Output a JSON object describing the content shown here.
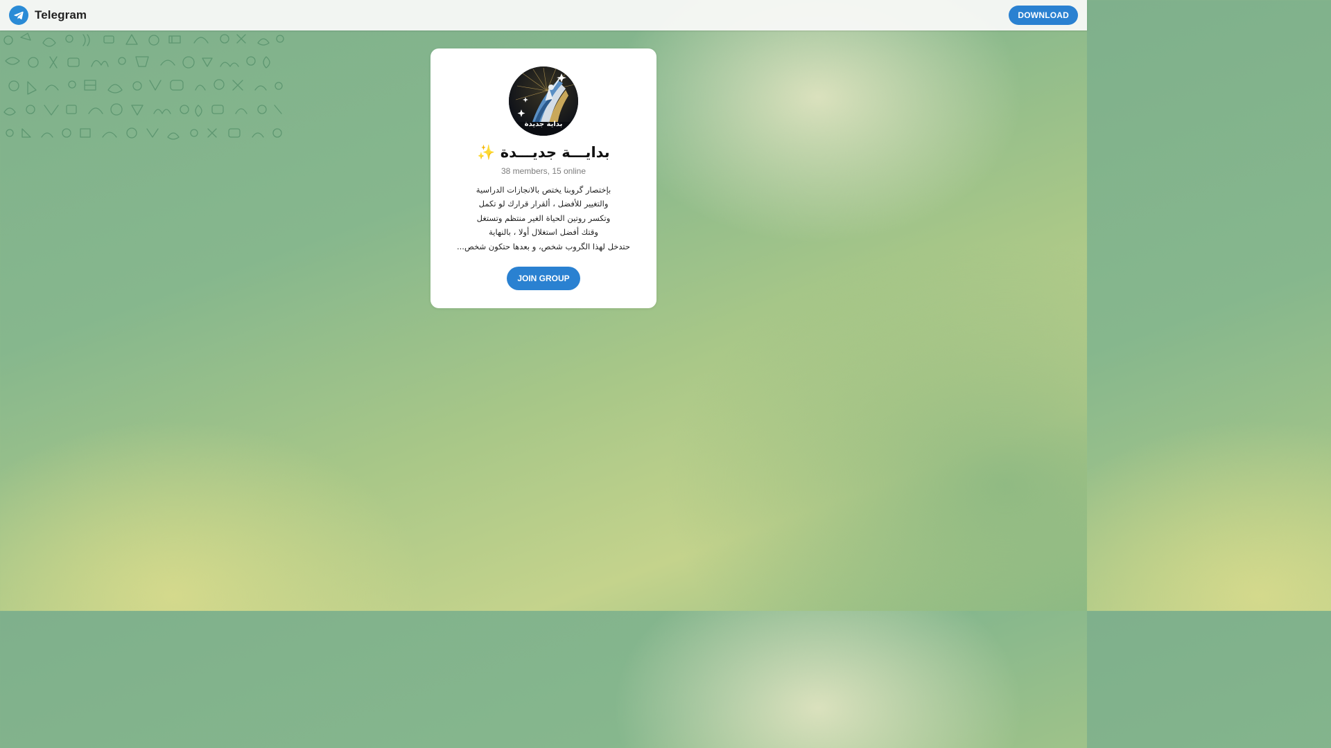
{
  "header": {
    "brand": "Telegram",
    "brand_icon": "telegram-paper-plane-icon",
    "download_label": "DOWNLOAD"
  },
  "group": {
    "avatar_caption": "بداية جديدة",
    "title": "بدايـــة جديـــدة ✨",
    "extra": "38 members, 15 online",
    "description_lines": [
      "بإختصار گروبنا يختص بالانجازات الدراسية",
      "والتغيير للأفضل ، ألقرار قرارك لو تكمل",
      "وتكسر روتين الحياة الغير منتظم وتستغل",
      "وقتك أفضل استغلال أولا ، بالنهاية",
      "حتدخل لهذا الگروب شخص، و بعدها حتكون شخص..."
    ],
    "join_label": "JOIN GROUP"
  },
  "colors": {
    "accent": "#2a81d1",
    "card_bg": "#ffffff",
    "title_text": "#111111",
    "meta_text": "#7c7c7c"
  }
}
